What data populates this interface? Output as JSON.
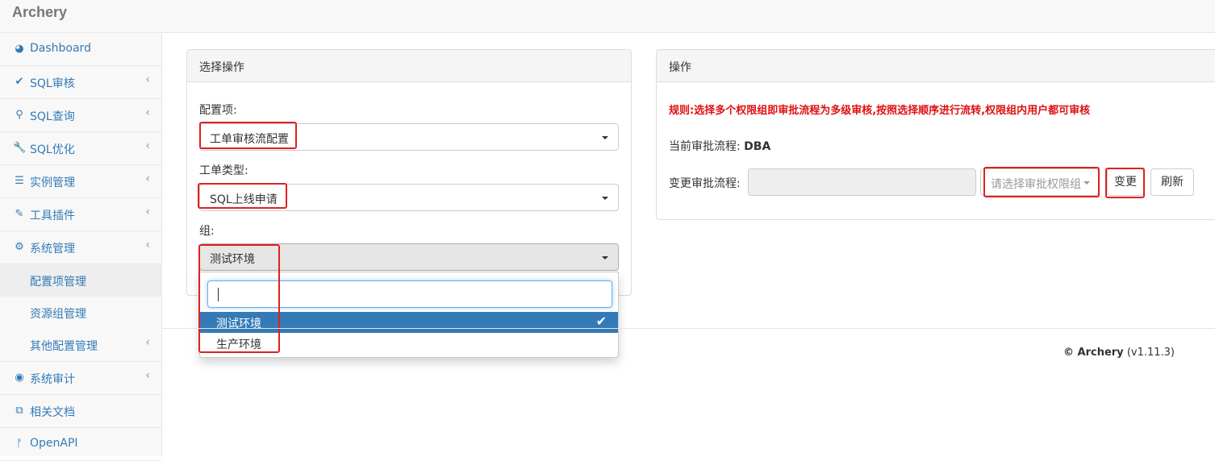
{
  "app": {
    "brand": "Archery"
  },
  "sidebar": {
    "items": [
      {
        "label": "Dashboard",
        "icon": "dashboard-icon",
        "glyph": "◕",
        "chevron": false
      },
      {
        "label": "SQL审核",
        "icon": "check-icon",
        "glyph": "✔",
        "chevron": true
      },
      {
        "label": "SQL查询",
        "icon": "search-icon",
        "glyph": "⚲",
        "chevron": true
      },
      {
        "label": "SQL优化",
        "icon": "wrench-icon",
        "glyph": "🔧",
        "chevron": true
      },
      {
        "label": "实例管理",
        "icon": "database-icon",
        "glyph": "☰",
        "chevron": true
      },
      {
        "label": "工具插件",
        "icon": "plug-icon",
        "glyph": "✎",
        "chevron": true
      },
      {
        "label": "系统管理",
        "icon": "gears-icon",
        "glyph": "⚙",
        "chevron": true
      }
    ],
    "sub_items": [
      {
        "label": "配置项管理",
        "active": true,
        "chevron": false
      },
      {
        "label": "资源组管理",
        "active": false,
        "chevron": false
      },
      {
        "label": "其他配置管理",
        "active": false,
        "chevron": true
      }
    ],
    "items_after": [
      {
        "label": "系统审计",
        "icon": "eye-icon",
        "glyph": "◉",
        "chevron": true
      },
      {
        "label": "相关文档",
        "icon": "sitemap-icon",
        "glyph": "⧉",
        "chevron": false
      },
      {
        "label": "OpenAPI",
        "icon": "code-branch-icon",
        "glyph": "ᚠ",
        "chevron": false
      }
    ],
    "chevron_glyph": "‹"
  },
  "left_panel": {
    "title": "选择操作",
    "config_label": "配置项:",
    "config_value": "工单审核流配置",
    "type_label": "工单类型:",
    "type_value": "SQL上线申请",
    "group_label": "组:",
    "group_value": "测试环境"
  },
  "group_dropdown": {
    "search_value": "",
    "options": [
      {
        "label": "测试环境",
        "selected": true
      },
      {
        "label": "生产环境",
        "selected": false
      }
    ],
    "check_glyph": "✔"
  },
  "right_panel": {
    "title": "操作",
    "rule": "规则:选择多个权限组即审批流程为多级审核,按照选择顺序进行流转,权限组内用户都可审核",
    "current_flow_label": "当前审批流程:",
    "current_flow_value": "DBA",
    "change_label": "变更审批流程:",
    "picker_placeholder": "请选择审批权限组",
    "change_button": "变更",
    "refresh_button": "刷新"
  },
  "footer": {
    "copyright": "© Archery",
    "version": "(v1.11.3)"
  },
  "colors": {
    "accent": "#337ab7",
    "highlight": "#e02020",
    "rule_text": "#e01010"
  }
}
